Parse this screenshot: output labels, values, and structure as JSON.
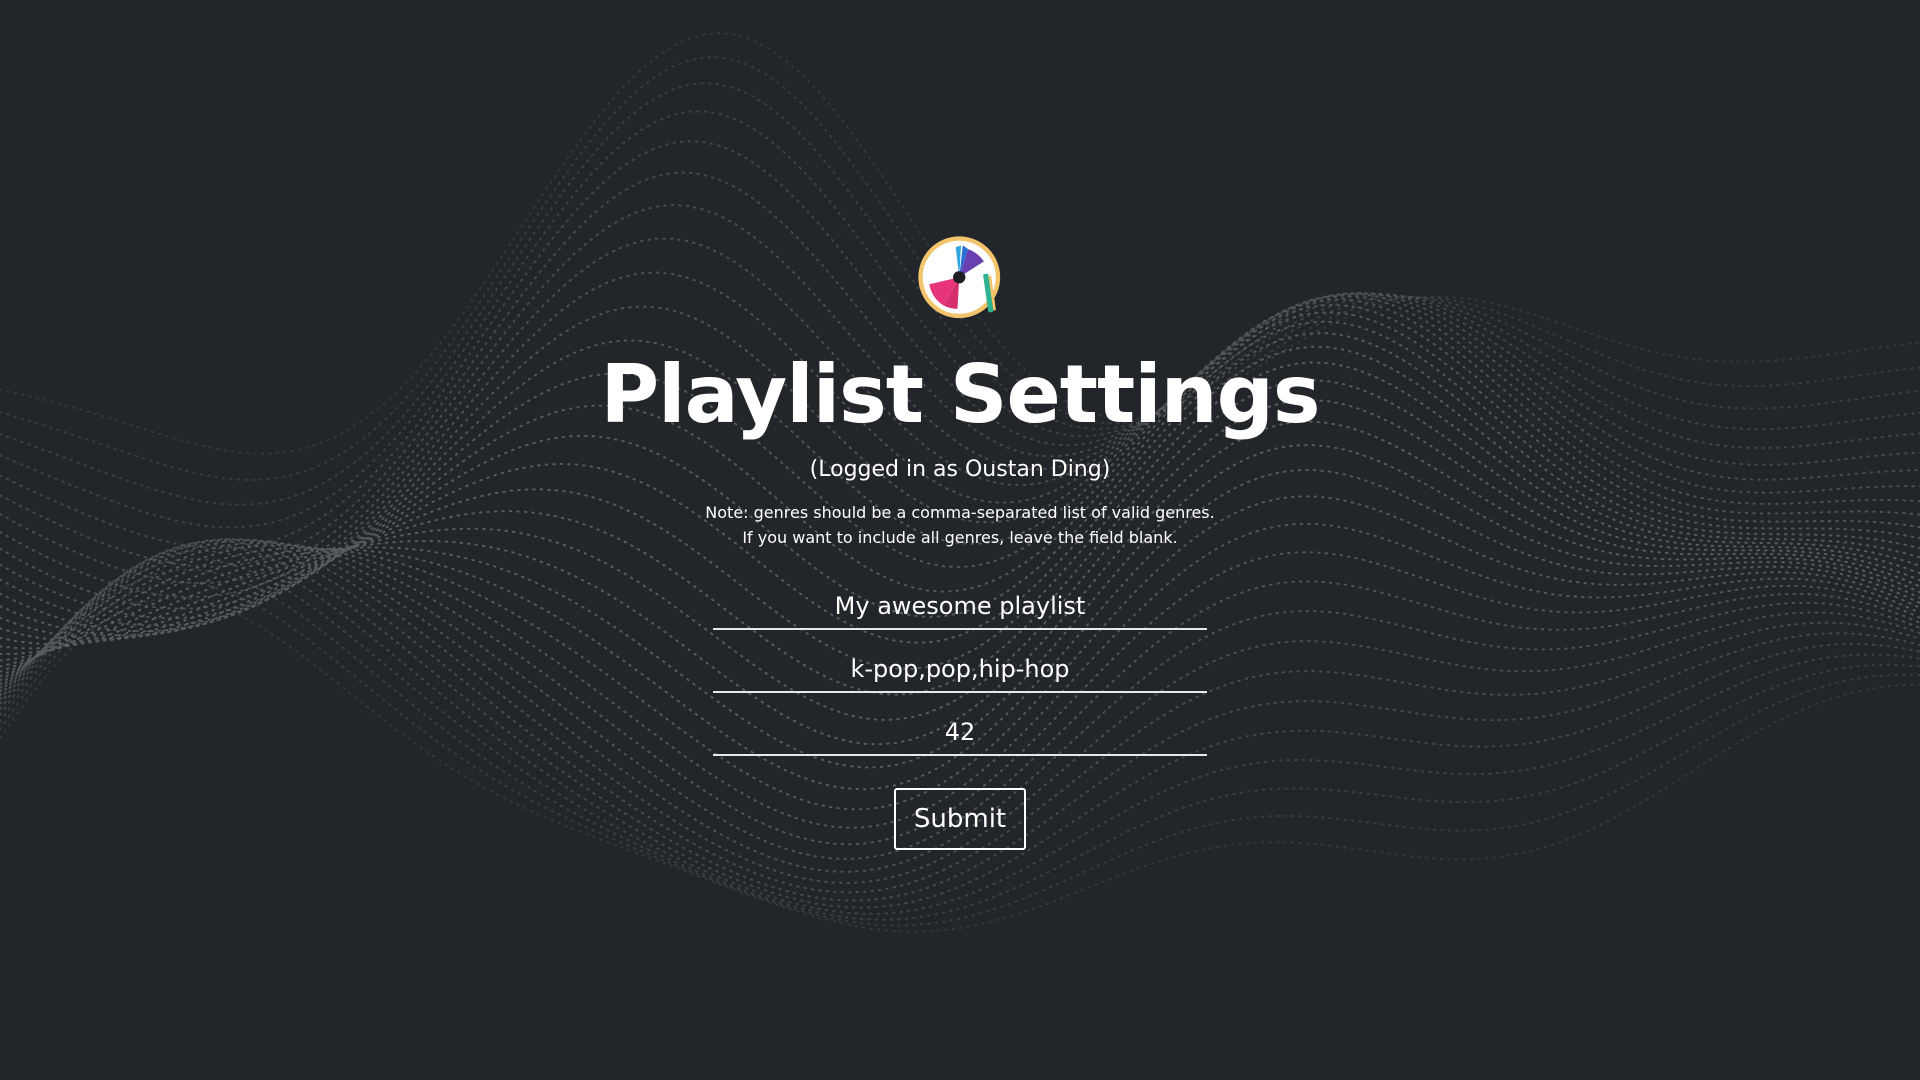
{
  "page": {
    "title": "Playlist Settings",
    "subtitle": "(Logged in as Oustan Ding)",
    "note": "Note: genres should be a comma-separated list of valid genres. If you want to include all genres, leave the field blank."
  },
  "form": {
    "playlist_name": "My awesome playlist",
    "genres": "k-pop,pop,hip-hop",
    "count": "42",
    "submit_label": "Submit"
  },
  "colors": {
    "background": "#222529",
    "wave_dots": "#6b6e72",
    "text": "#ffffff"
  },
  "icons": {
    "logo": "music-disc-logo-icon"
  }
}
